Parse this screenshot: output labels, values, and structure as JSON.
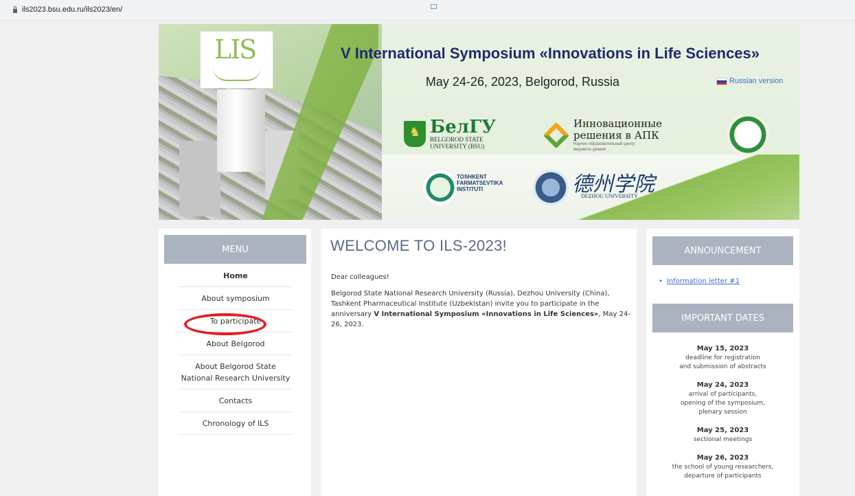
{
  "browser": {
    "url": "ils2023.bsu.edu.ru/ils2023/en/"
  },
  "banner": {
    "logo_text": "LIS",
    "title": "V International Symposium «Innovations in Life Sciences»",
    "date": "May 24-26, 2023, Belgorod, Russia",
    "russian_link": "Russian version",
    "bsu_big": "БелГУ",
    "bsu_line1": "BELGOROD STATE",
    "bsu_line2": "UNIVERSITY (BSU)",
    "apk_line1": "Инновационные",
    "apk_line2": "решения в АПК",
    "apk_sub1": "Научно-образовательный центр",
    "apk_sub2": "мирового уровня",
    "tpi_line1": "TOSHKENT",
    "tpi_line2": "FARMATSEVTIKA",
    "tpi_line3": "INSTITUTI",
    "dezhou_chinese": "德州学院",
    "dezhou_latin": "DEZHOU UNIVERSITY"
  },
  "menu": {
    "header": "MENU",
    "items": [
      {
        "label": "Home"
      },
      {
        "label": "About symposium"
      },
      {
        "label": "To participate"
      },
      {
        "label": "About Belgorod"
      },
      {
        "label": "About Belgorod State National Research University"
      },
      {
        "label": "Contacts"
      },
      {
        "label": "Chronology of ILS"
      }
    ]
  },
  "main": {
    "heading": "WELCOME TO ILS-2023!",
    "greeting": "Dear colleagues!",
    "intro_before": "Belgorod State National Research University (Russia), Dezhou University (China), Tashkent Pharmaceutical Institute (Uzbekistan) invite you to participate in the anniversary ",
    "intro_bold": "V International Symposium «Innovations in Life Sciences»",
    "intro_after": ", May 24-26, 2023."
  },
  "right": {
    "announcement_header": "ANNOUNCEMENT",
    "announcement_link": "Information letter #1",
    "dates_header": "IMPORTANT DATES",
    "dates": [
      {
        "date": "May 15, 2023",
        "lines": [
          "deadline for registration",
          "and submission of abstracts"
        ]
      },
      {
        "date": "May 24, 2023",
        "lines": [
          "arrival of participants,",
          "opening of the symposium,",
          "plenary session"
        ]
      },
      {
        "date": "May 25, 2023",
        "lines": [
          "sectional meetings"
        ]
      },
      {
        "date": "May 26, 2023",
        "lines": [
          "the school of young researchers,",
          "departure of participants"
        ]
      }
    ]
  },
  "colors": {
    "accent_header": "#abb2c0",
    "title_blue": "#1f2a6e",
    "link_blue": "#3b6fc7",
    "highlight_red": "#e31e24"
  }
}
